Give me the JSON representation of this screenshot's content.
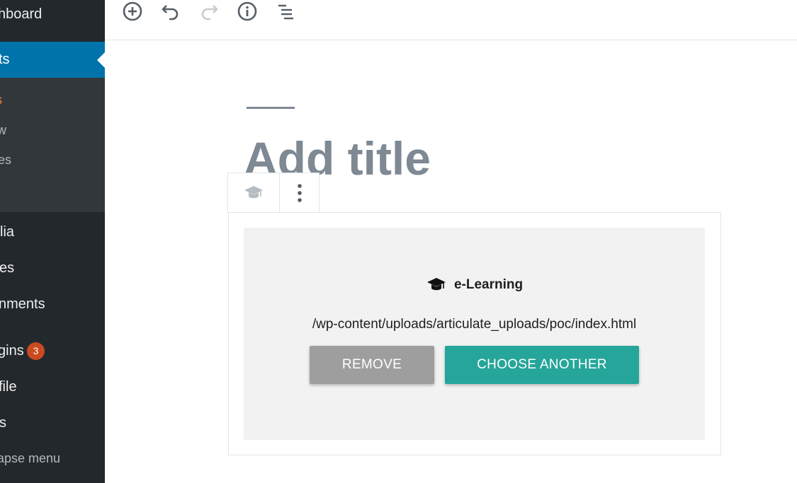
{
  "sidebar": {
    "items": [
      {
        "label": "hboard"
      },
      {
        "label": "ts"
      },
      {
        "label": "lia"
      },
      {
        "label": "es"
      },
      {
        "label": "nments"
      },
      {
        "label": "gins"
      },
      {
        "label": "file"
      },
      {
        "label": "s"
      }
    ],
    "submenu": [
      {
        "label": "s"
      },
      {
        "label": "w"
      },
      {
        "label": "es"
      }
    ],
    "plugins_badge": "3",
    "collapse_label": "apse menu",
    "colors": {
      "background": "#23282d",
      "active": "#0073aa",
      "submenu": "#32373c",
      "badge": "#ca4a1f"
    }
  },
  "toolbar": {
    "icons": [
      "add-block-icon",
      "undo-icon",
      "redo-icon",
      "info-icon",
      "outline-icon"
    ]
  },
  "editor": {
    "title_placeholder": "Add title",
    "block_toolbar": {
      "icons": [
        "graduation-cap-icon",
        "more-options-icon"
      ]
    },
    "block": {
      "name": "e-Learning",
      "file_path": "/wp-content/uploads/articulate_uploads/poc/index.html",
      "remove_label": "REMOVE",
      "choose_label": "CHOOSE ANOTHER",
      "colors": {
        "remove": "#9e9e9e",
        "choose": "#26a69a"
      }
    }
  }
}
